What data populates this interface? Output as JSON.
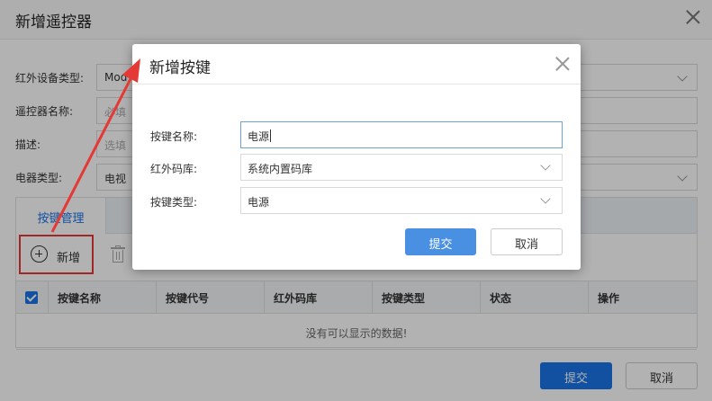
{
  "outer_dialog": {
    "title": "新增遥控器",
    "fields": [
      {
        "label": "红外设备类型:",
        "value": "Mod",
        "placeholder": ""
      },
      {
        "label": "遥控器名称:",
        "value": "",
        "placeholder": "必填"
      },
      {
        "label": "描述:",
        "value": "",
        "placeholder": "选填"
      },
      {
        "label": "电器类型:",
        "value": "电视",
        "placeholder": ""
      }
    ],
    "tabs": [
      {
        "label": "按键管理",
        "active": true
      }
    ],
    "toolbar": {
      "add_label": "新增"
    },
    "table": {
      "columns": [
        "按键名称",
        "按键代号",
        "红外码库",
        "按键类型",
        "状态",
        "操作"
      ],
      "empty_text": "没有可以显示的数据!"
    },
    "submit_label": "提交",
    "cancel_label": "取消"
  },
  "modal": {
    "title": "新增按键",
    "fields": [
      {
        "label": "按键名称:",
        "value": "电源"
      },
      {
        "label": "红外码库:",
        "value": "系统内置码库"
      },
      {
        "label": "按键类型:",
        "value": "电源"
      }
    ],
    "submit_label": "提交",
    "cancel_label": "取消"
  },
  "colors": {
    "primary": "#1a73e8",
    "annotation": "#e53935",
    "mask": "rgba(0,0,0,0.30)"
  }
}
